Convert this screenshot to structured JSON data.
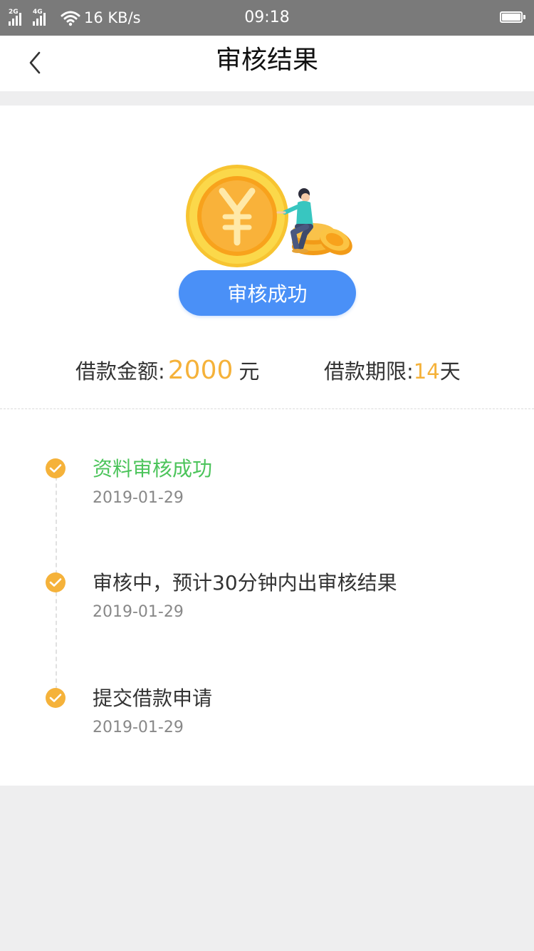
{
  "status_bar": {
    "sim1_tag": "2G",
    "sim2_tag": "4G",
    "net_speed": "16 KB/s",
    "time": "09:18"
  },
  "nav": {
    "title": "审核结果"
  },
  "result": {
    "badge_label": "审核成功"
  },
  "loan": {
    "amount_label": "借款金额:",
    "amount_value": "2000",
    "amount_unit": "元",
    "term_label": "借款期限:",
    "term_value": "14",
    "term_unit": "天"
  },
  "timeline": {
    "steps": [
      {
        "title": "资料审核成功",
        "date": "2019-01-29"
      },
      {
        "title": "审核中，预计30分钟内出审核结果",
        "date": "2019-01-29"
      },
      {
        "title": "提交借款申请",
        "date": "2019-01-29"
      }
    ]
  },
  "colors": {
    "accent_orange": "#F5B23A",
    "badge_blue": "#4A90F7",
    "success_green": "#4CC45B",
    "status_bar_gray": "#7A7A7A"
  }
}
